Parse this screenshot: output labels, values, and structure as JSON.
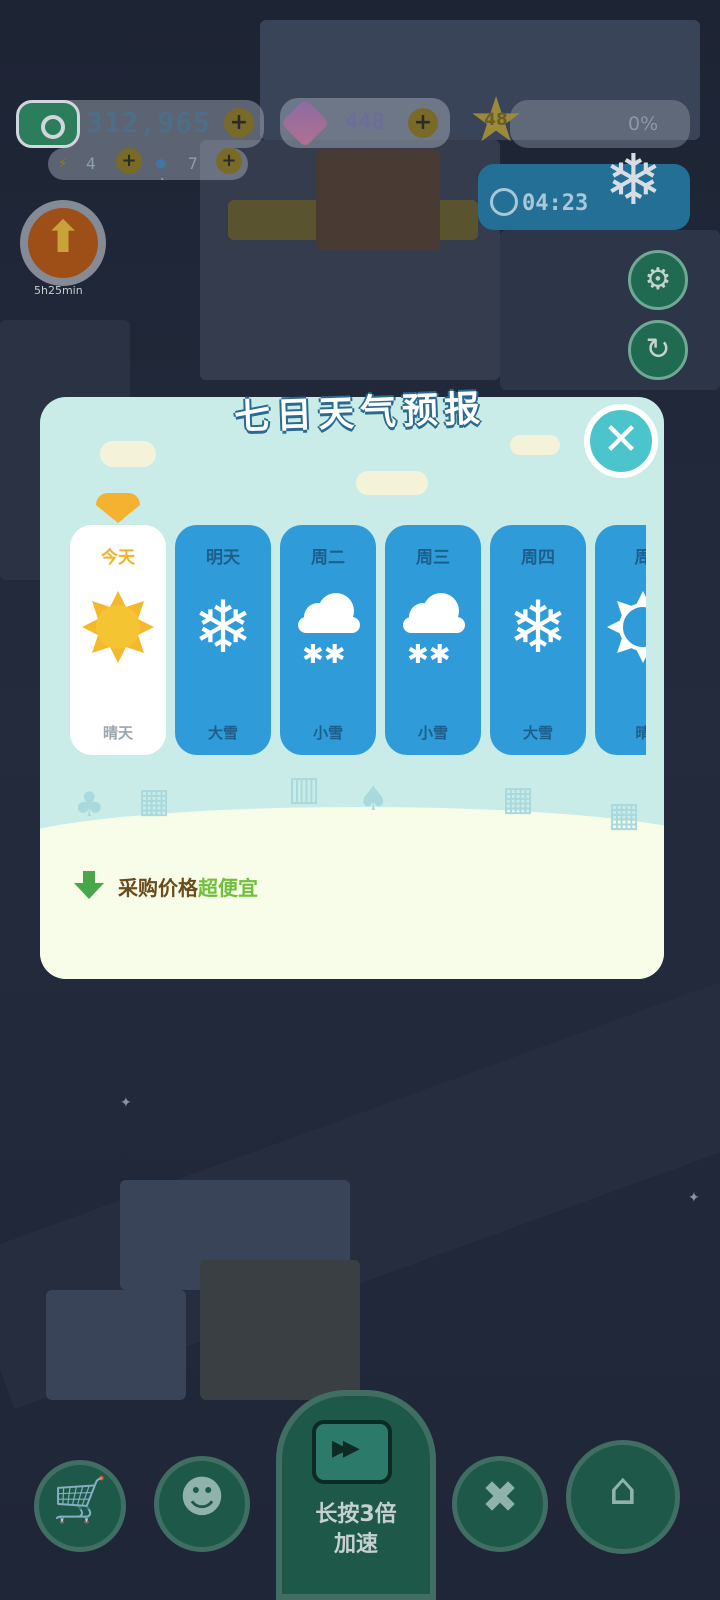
{
  "hud": {
    "money": "312,965",
    "energy": "4",
    "water": "7",
    "gems": "448",
    "level": "48",
    "xp_percent": "0%",
    "timer": "04:23",
    "boost_timer": "5h25min"
  },
  "dialog": {
    "title": "七日天气预报",
    "close_icon": "close-icon",
    "days": [
      {
        "name": "今天",
        "weather": "晴天",
        "icon": "sun-icon",
        "selected": true
      },
      {
        "name": "明天",
        "weather": "大雪",
        "icon": "snowflake-icon",
        "selected": false
      },
      {
        "name": "周二",
        "weather": "小雪",
        "icon": "snow-cloud-icon",
        "selected": false
      },
      {
        "name": "周三",
        "weather": "小雪",
        "icon": "snow-cloud-icon",
        "selected": false
      },
      {
        "name": "周四",
        "weather": "大雪",
        "icon": "snowflake-icon",
        "selected": false
      },
      {
        "name": "周",
        "weather": "晴",
        "icon": "sun-icon",
        "selected": false
      }
    ],
    "feature": {
      "text": "采购价格",
      "highlight": "超便宜"
    }
  },
  "dock": {
    "speed_label_line1": "长按3倍",
    "speed_label_line2": "加速"
  },
  "colors": {
    "day_card": "#2f9bd9",
    "today_card": "#ffffff",
    "today_text": "#f1b226",
    "dialog_bg": "#c9ece8",
    "close_btn": "#4cc4cc",
    "highlight": "#6fbf3a"
  }
}
